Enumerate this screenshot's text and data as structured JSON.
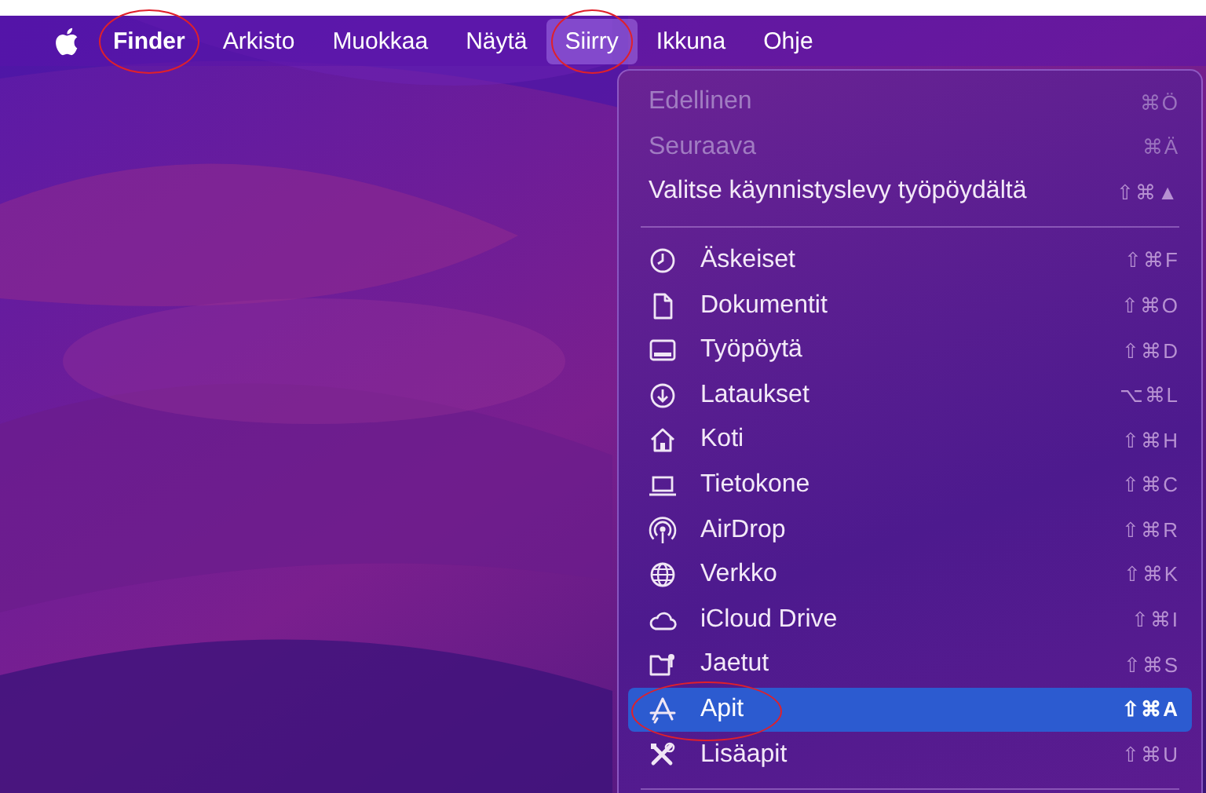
{
  "menubar": {
    "items": [
      {
        "label": "Finder",
        "bold": true,
        "selected": false,
        "circled": true
      },
      {
        "label": "Arkisto",
        "bold": false,
        "selected": false,
        "circled": false
      },
      {
        "label": "Muokkaa",
        "bold": false,
        "selected": false,
        "circled": false
      },
      {
        "label": "Näytä",
        "bold": false,
        "selected": false,
        "circled": false
      },
      {
        "label": "Siirry",
        "bold": false,
        "selected": true,
        "circled": true
      },
      {
        "label": "Ikkuna",
        "bold": false,
        "selected": false,
        "circled": false
      },
      {
        "label": "Ohje",
        "bold": false,
        "selected": false,
        "circled": false
      }
    ]
  },
  "menu": {
    "items": [
      {
        "kind": "item",
        "label": "Edellinen",
        "shortcut": "⌘Ö",
        "disabled": true,
        "selected": false,
        "circled": false
      },
      {
        "kind": "item",
        "label": "Seuraava",
        "shortcut": "⌘Ä",
        "disabled": true,
        "selected": false,
        "circled": false
      },
      {
        "kind": "item",
        "label": "Valitse käynnistyslevy työpöydältä",
        "shortcut": "⇧⌘▲",
        "disabled": false,
        "selected": false,
        "circled": false
      },
      {
        "kind": "separator"
      },
      {
        "kind": "place",
        "label": "Äskeiset",
        "shortcut": "⇧⌘F",
        "disabled": false,
        "selected": false,
        "circled": false
      },
      {
        "kind": "place",
        "label": "Dokumentit",
        "shortcut": "⇧⌘O",
        "disabled": false,
        "selected": false,
        "circled": false
      },
      {
        "kind": "place",
        "label": "Työpöytä",
        "shortcut": "⇧⌘D",
        "disabled": false,
        "selected": false,
        "circled": false
      },
      {
        "kind": "place",
        "label": "Lataukset",
        "shortcut": "⌥⌘L",
        "disabled": false,
        "selected": false,
        "circled": false
      },
      {
        "kind": "place",
        "label": "Koti",
        "shortcut": "⇧⌘H",
        "disabled": false,
        "selected": false,
        "circled": false
      },
      {
        "kind": "place",
        "label": "Tietokone",
        "shortcut": "⇧⌘C",
        "disabled": false,
        "selected": false,
        "circled": false
      },
      {
        "kind": "place",
        "label": "AirDrop",
        "shortcut": "⇧⌘R",
        "disabled": false,
        "selected": false,
        "circled": false
      },
      {
        "kind": "place",
        "label": "Verkko",
        "shortcut": "⇧⌘K",
        "disabled": false,
        "selected": false,
        "circled": false
      },
      {
        "kind": "place",
        "label": "iCloud Drive",
        "shortcut": "⇧⌘I",
        "disabled": false,
        "selected": false,
        "circled": false
      },
      {
        "kind": "place",
        "label": "Jaetut",
        "shortcut": "⇧⌘S",
        "disabled": false,
        "selected": false,
        "circled": false
      },
      {
        "kind": "place",
        "label": "Apit",
        "shortcut": "⇧⌘A",
        "disabled": false,
        "selected": true,
        "circled": true
      },
      {
        "kind": "place",
        "label": "Lisäapit",
        "shortcut": "⇧⌘U",
        "disabled": false,
        "selected": false,
        "circled": false
      },
      {
        "kind": "separator"
      }
    ]
  }
}
